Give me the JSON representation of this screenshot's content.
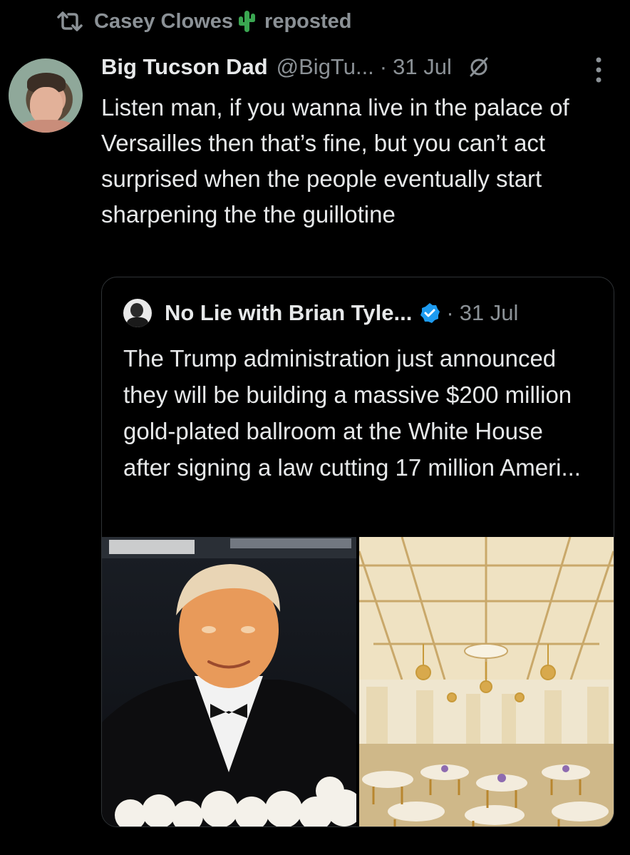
{
  "repost": {
    "user": "Casey Clowes",
    "label": "reposted"
  },
  "tweet": {
    "name": "Big Tucson Dad",
    "handle": "@BigTu...",
    "separator": "·",
    "date": "31 Jul",
    "text": "Listen man, if you wanna live in the palace of Versailles then that’s fine, but you can’t act surprised when the people eventually start sharpening the the guillotine"
  },
  "quote": {
    "name": "No Lie with Brian Tyle...",
    "separator": "·",
    "date": "31 Jul",
    "text": "The Trump administration just announced they will be building a massive $200 million gold-plated ballroom at the White House after signing a law cutting 17 million Ameri...",
    "verified_color": "#1d9bf0"
  },
  "icons": {
    "repost": "repost-icon",
    "cactus": "cactus-emoji",
    "grok": "grok-icon",
    "more": "more-icon",
    "verified": "verified-badge-icon"
  }
}
